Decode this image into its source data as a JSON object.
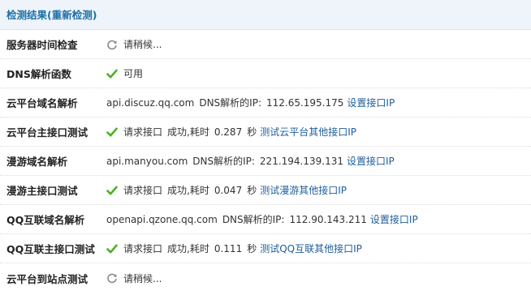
{
  "header": {
    "title": "检测结果(重新检测)"
  },
  "colors": {
    "link": "#1f5e99",
    "ok": "#4caf26",
    "header_text": "#1b6fa8",
    "header_bg": "#eef4fa"
  },
  "rows": [
    {
      "label": "服务器时间检查",
      "icon": "refresh-icon",
      "text": "请稍候..."
    },
    {
      "label": "DNS解析函数",
      "icon": "check-icon",
      "text": "可用"
    },
    {
      "label": "云平台域名解析",
      "host": "api.discuz.qq.com",
      "dns_text": "DNS解析的IP:",
      "ip": "112.65.195.175",
      "link": "设置接口IP"
    },
    {
      "label": "云平台主接口测试",
      "icon": "check-icon",
      "status": "请求接口",
      "result": "成功,耗时",
      "time": "0.287",
      "unit": "秒",
      "link": "测试云平台其他接口IP"
    },
    {
      "label": "漫游域名解析",
      "host": "api.manyou.com",
      "dns_text": "DNS解析的IP:",
      "ip": "221.194.139.131",
      "link": "设置接口IP"
    },
    {
      "label": "漫游主接口测试",
      "icon": "check-icon",
      "status": "请求接口",
      "result": "成功,耗时",
      "time": "0.047",
      "unit": "秒",
      "link": "测试漫游其他接口IP"
    },
    {
      "label": "QQ互联域名解析",
      "host": "openapi.qzone.qq.com",
      "dns_text": "DNS解析的IP:",
      "ip": "112.90.143.211",
      "link": "设置接口IP"
    },
    {
      "label": "QQ互联主接口测试",
      "icon": "check-icon",
      "status": "请求接口",
      "result": "成功,耗时",
      "time": "0.111",
      "unit": "秒",
      "link": "测试QQ互联其他接口IP"
    },
    {
      "label": "云平台到站点测试",
      "icon": "refresh-icon",
      "text": "请稍候..."
    }
  ]
}
